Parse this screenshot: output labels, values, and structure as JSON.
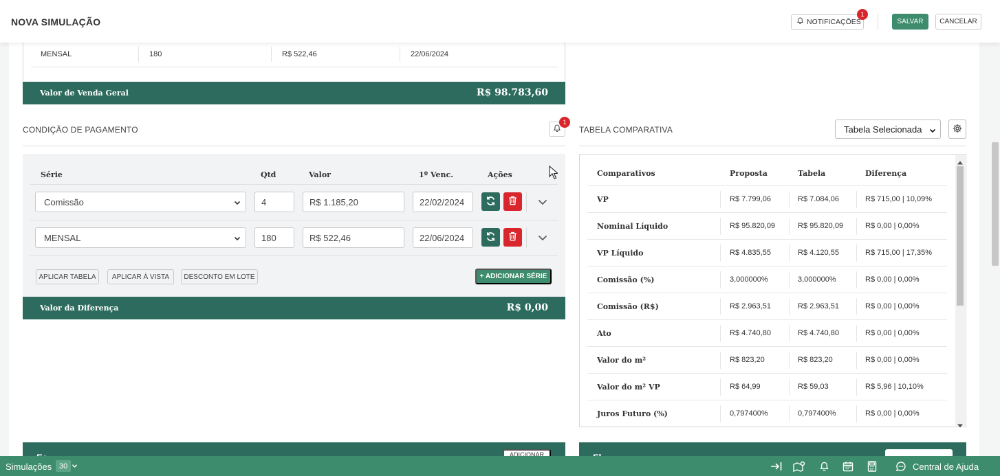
{
  "header": {
    "title": "NOVA SIMULAÇÃO",
    "notifications_label": "NOTIFICAÇÕES",
    "notifications_count": "1",
    "save_label": "SALVAR",
    "cancel_label": "CANCELAR"
  },
  "top_card": {
    "row": {
      "serie": "MENSAL",
      "qtd": "180",
      "valor": "R$ 522,46",
      "vencimento": "22/06/2024"
    },
    "total_label": "Valor de Venda Geral",
    "total_value": "R$ 98.783,60"
  },
  "payment": {
    "title": "CONDIÇÃO DE PAGAMENTO",
    "bell_count": "1",
    "columns": {
      "serie": "Série",
      "qtd": "Qtd",
      "valor": "Valor",
      "vencimento": "1º Venc.",
      "acoes": "Ações"
    },
    "rows": [
      {
        "serie": "Comissão",
        "qtd": "4",
        "valor": "R$ 1.185,20",
        "vencimento": "22/02/2024"
      },
      {
        "serie": "MENSAL",
        "qtd": "180",
        "valor": "R$ 522,46",
        "vencimento": "22/06/2024"
      }
    ],
    "buttons": {
      "aplicar_tabela": "APLICAR TABELA",
      "aplicar_vista": "APLICAR À VISTA",
      "desconto_lote": "DESCONTO EM LOTE",
      "adicionar_serie": "+ ADICIONAR SÉRIE"
    },
    "diff_label": "Valor da Diferença",
    "diff_value": "R$ 0,00"
  },
  "comparative": {
    "title": "TABELA COMPARATIVA",
    "select_value": "Tabela Selecionada",
    "columns": {
      "item": "Comparativos",
      "proposta": "Proposta",
      "tabela": "Tabela",
      "diferenca": "Diferença"
    },
    "rows": [
      {
        "item": "VP",
        "proposta": "R$ 7.799,06",
        "tabela": "R$ 7.084,06",
        "diferenca": "R$ 715,00 | 10,09%"
      },
      {
        "item": "Nominal Líquido",
        "proposta": "R$ 95.820,09",
        "tabela": "R$ 95.820,09",
        "diferenca": "R$ 0,00 | 0,00%"
      },
      {
        "item": "VP Líquido",
        "proposta": "R$ 4.835,55",
        "tabela": "R$ 4.120,55",
        "diferenca": "R$ 715,00 | 17,35%"
      },
      {
        "item": "Comissão (%)",
        "proposta": "3,000000%",
        "tabela": "3,000000%",
        "diferenca": "R$ 0,00 | 0,00%"
      },
      {
        "item": "Comissão (R$)",
        "proposta": "R$ 2.963,51",
        "tabela": "R$ 2.963,51",
        "diferenca": "R$ 0,00 | 0,00%"
      },
      {
        "item": "Ato",
        "proposta": "R$ 4.740,80",
        "tabela": "R$ 4.740,80",
        "diferenca": "R$ 0,00 | 0,00%"
      },
      {
        "item": "Valor do m²",
        "proposta": "R$ 823,20",
        "tabela": "R$ 823,20",
        "diferenca": "R$ 0,00 | 0,00%"
      },
      {
        "item": "Valor do m² VP",
        "proposta": "R$ 64,99",
        "tabela": "R$ 59,03",
        "diferenca": "R$ 5,96 | 10,10%"
      },
      {
        "item": "Juros Futuro (%)",
        "proposta": "0,797400%",
        "tabela": "0,797400%",
        "diferenca": "R$ 0,00 | 0,00%"
      }
    ]
  },
  "bottom_cards": {
    "left_title": "Fa",
    "left_button": "ADICIONAR",
    "right_title": "Fl"
  },
  "status_bar": {
    "simulations_label": "Simulações",
    "simulations_count": "30",
    "help_label": "Central de Ajuda"
  },
  "colors": {
    "primary_dark": "#2c6b5d",
    "primary": "#3d8c6d",
    "danger": "#d9262c"
  }
}
